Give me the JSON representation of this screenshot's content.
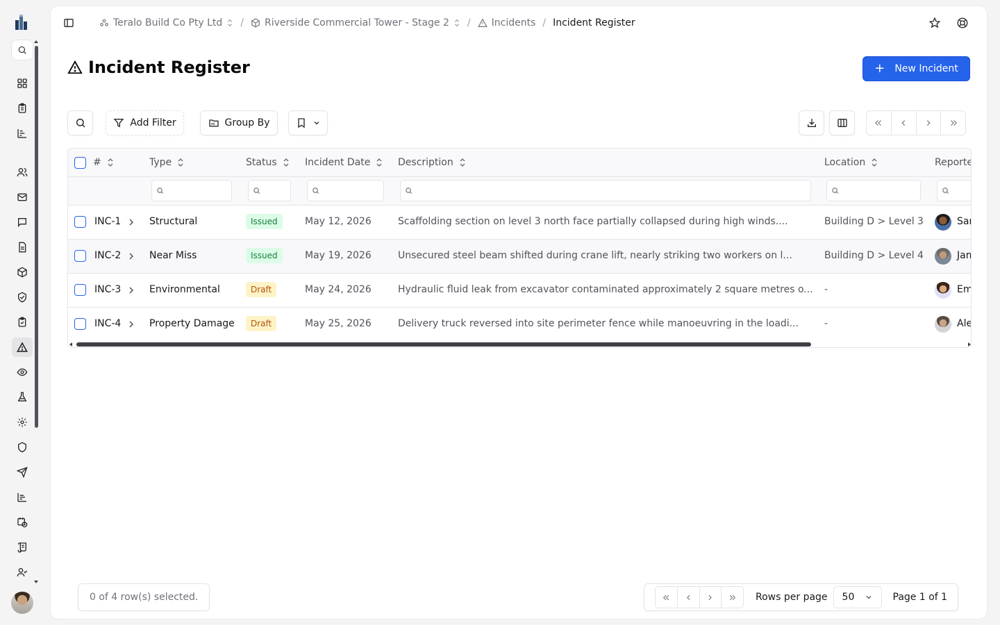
{
  "breadcrumb": {
    "company": "Teralo Build Co Pty Ltd",
    "project": "Riverside Commercial Tower - Stage 2",
    "section": "Incidents",
    "current": "Incident Register"
  },
  "page": {
    "title": "Incident Register"
  },
  "actions": {
    "new_incident": "New Incident"
  },
  "toolbar": {
    "add_filter": "Add Filter",
    "group_by": "Group By"
  },
  "table": {
    "columns": {
      "number": "#",
      "type": "Type",
      "status": "Status",
      "incident_date": "Incident Date",
      "description": "Description",
      "location": "Location",
      "reporter": "Reporte"
    },
    "rows": [
      {
        "id": "INC-1",
        "type": "Structural",
        "status": "Issued",
        "date": "May 12, 2026",
        "description": "Scaffolding section on level 3 north face partially collapsed during high winds....",
        "location": "Building D > Level 3",
        "reporter": "Sar"
      },
      {
        "id": "INC-2",
        "type": "Near Miss",
        "status": "Issued",
        "date": "May 19, 2026",
        "description": "Unsecured steel beam shifted during crane lift, nearly striking two workers on l...",
        "location": "Building D > Level 4",
        "reporter": "Jam"
      },
      {
        "id": "INC-3",
        "type": "Environmental",
        "status": "Draft",
        "date": "May 24, 2026",
        "description": "Hydraulic fluid leak from excavator contaminated approximately 2 square metres o...",
        "location": "-",
        "reporter": "Em"
      },
      {
        "id": "INC-4",
        "type": "Property Damage",
        "status": "Draft",
        "date": "May 25, 2026",
        "description": "Delivery truck reversed into site perimeter fence while manoeuvring in the loadi...",
        "location": "-",
        "reporter": "Ale"
      }
    ]
  },
  "footer": {
    "selection": "0 of 4 row(s) selected.",
    "rows_per_page_label": "Rows per page",
    "rows_per_page_value": "50",
    "page_indicator": "Page 1 of 1"
  },
  "colors": {
    "accent": "#2563eb",
    "issued_bg": "#dcfce7",
    "issued_fg": "#15803d",
    "draft_bg": "#fef3c7",
    "draft_fg": "#b45309"
  }
}
